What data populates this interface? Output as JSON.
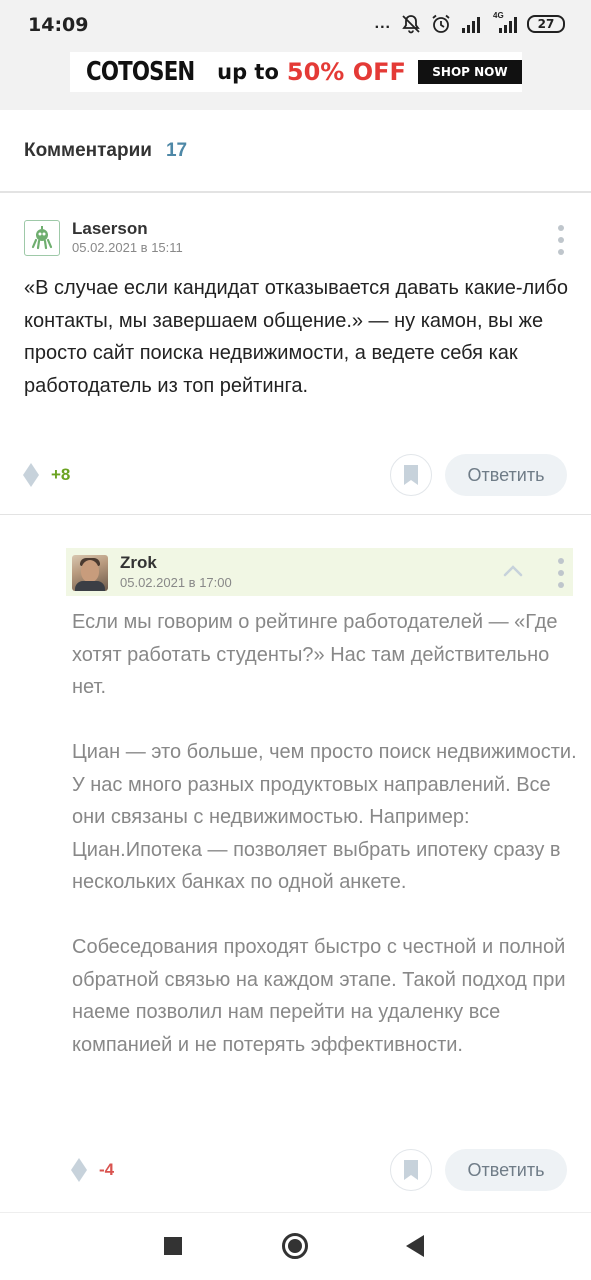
{
  "status_bar": {
    "time": "14:09",
    "dots": "...",
    "signal_2_label": "4G",
    "battery": "27"
  },
  "ad": {
    "brand": "COTOSEN",
    "up_to": "up to",
    "offer": "50% OFF",
    "cta": "SHOP NOW"
  },
  "comments": {
    "title": "Комментарии",
    "count": "17"
  },
  "comment_1": {
    "author": "Laserson",
    "date": "05.02.2021 в 15:11",
    "text": "«В случае если кандидат отказывается давать какие-либо контакты, мы завершаем общение.» — ну камон, вы же просто сайт поиска недвижимости, а ведете себя как работодатель из топ рейтинга.",
    "score": "+8",
    "score_color": "#6ba321",
    "reply_label": "Ответить"
  },
  "comment_2": {
    "author": "Zrok",
    "date": "05.02.2021 в 17:00",
    "paragraphs": [
      "Если мы говорим о рейтинге работодателей — «Где хотят работать студенты?» Нас там действительно нет.",
      "Циан — это больше, чем просто поиск недвижимости. У нас много разных продуктовых направлений. Все они связаны с недвижимостью. Например: Циан.Ипотека — позволяет выбрать ипотеку сразу в нескольких банках по одной анкете.",
      "Собеседования проходят быстро с честной и полной обратной связью на каждом этапе. Такой подход при наеме позволил нам перейти на удаленку все компанией и не потерять эффективности."
    ],
    "score": "-4",
    "score_color": "#d9534f",
    "reply_label": "Ответить"
  },
  "icons": {
    "mute": "bell-muted-icon",
    "alarm": "alarm-icon",
    "more": "more-vertical-icon",
    "vote": "vote-diamond-icon",
    "bookmark": "bookmark-icon",
    "collapse": "chevron-up-icon",
    "nav_recents": "recents-square-icon",
    "nav_home": "home-circle-icon",
    "nav_back": "back-triangle-icon"
  }
}
